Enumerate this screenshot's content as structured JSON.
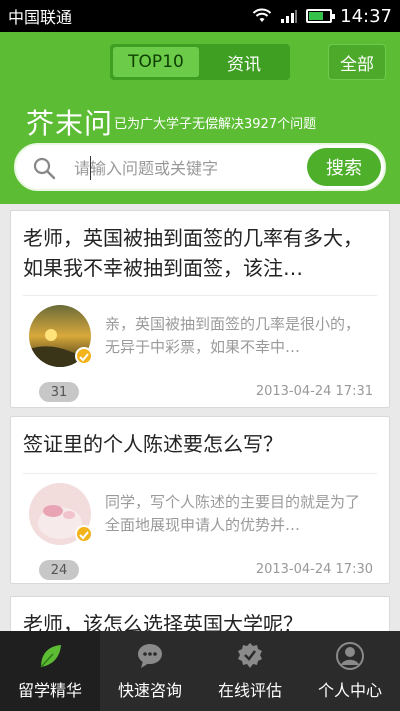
{
  "statusbar": {
    "carrier": "中国联通",
    "time": "14:37",
    "battery_level": 0.7
  },
  "header": {
    "tabs": [
      {
        "label": "TOP10",
        "active": true
      },
      {
        "label": "资讯",
        "active": false
      }
    ],
    "all_button": "全部",
    "brand": "芥末问",
    "tagline": "已为广大学子无偿解决3927个问题"
  },
  "search": {
    "placeholder": "请输入问题或关键字",
    "button": "搜索"
  },
  "questions": [
    {
      "title": "老师，英国被抽到面签的几率有多大，如果我不幸被抽到面签，该注…",
      "answer": "亲，英国被抽到面签的几率是很小的，无异于中彩票，如果不幸中…",
      "count": "31",
      "date": "2013-04-24 17:31"
    },
    {
      "title": "签证里的个人陈述要怎么写？",
      "answer": "同学，写个人陈述的主要目的就是为了全面地展现申请人的优势并…",
      "count": "24",
      "date": "2013-04-24 17:30"
    },
    {
      "title": "老师，该怎么选择英国大学呢？"
    }
  ],
  "nav": [
    {
      "label": "留学精华",
      "icon": "leaf-icon",
      "active": true
    },
    {
      "label": "快速咨询",
      "icon": "chat-bubble-icon",
      "active": false
    },
    {
      "label": "在线评估",
      "icon": "check-badge-icon",
      "active": false
    },
    {
      "label": "个人中心",
      "icon": "person-icon",
      "active": false
    }
  ],
  "colors": {
    "header_green": "#5cbd35",
    "accent_green": "#4eaf2b",
    "badge_gold": "#f3b31b",
    "nav_bg": "#2b2b2b"
  }
}
